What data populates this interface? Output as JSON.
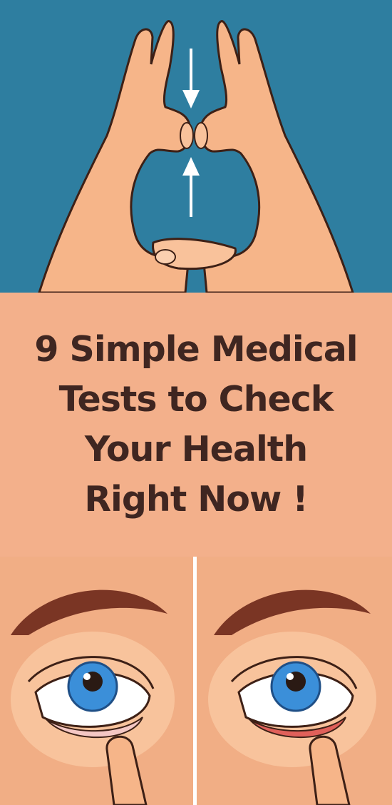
{
  "title": {
    "lines": [
      "9 Simple Medical",
      "Tests to Check",
      "Your Health",
      "Right Now !"
    ]
  },
  "illustrations": {
    "top": {
      "icon": "hands-heart-icon",
      "arrows": [
        "arrow-down-icon",
        "arrow-up-icon"
      ]
    },
    "bottom": {
      "left": "eye-lid-pale-icon",
      "right": "eye-lid-red-icon"
    }
  },
  "colors": {
    "top_background": "#2e7ea0",
    "title_background": "#f3b08b",
    "title_text": "#3f2621",
    "skin": "#f6b589",
    "iris": "#3b8fd9",
    "eyebrow": "#7a3524"
  }
}
